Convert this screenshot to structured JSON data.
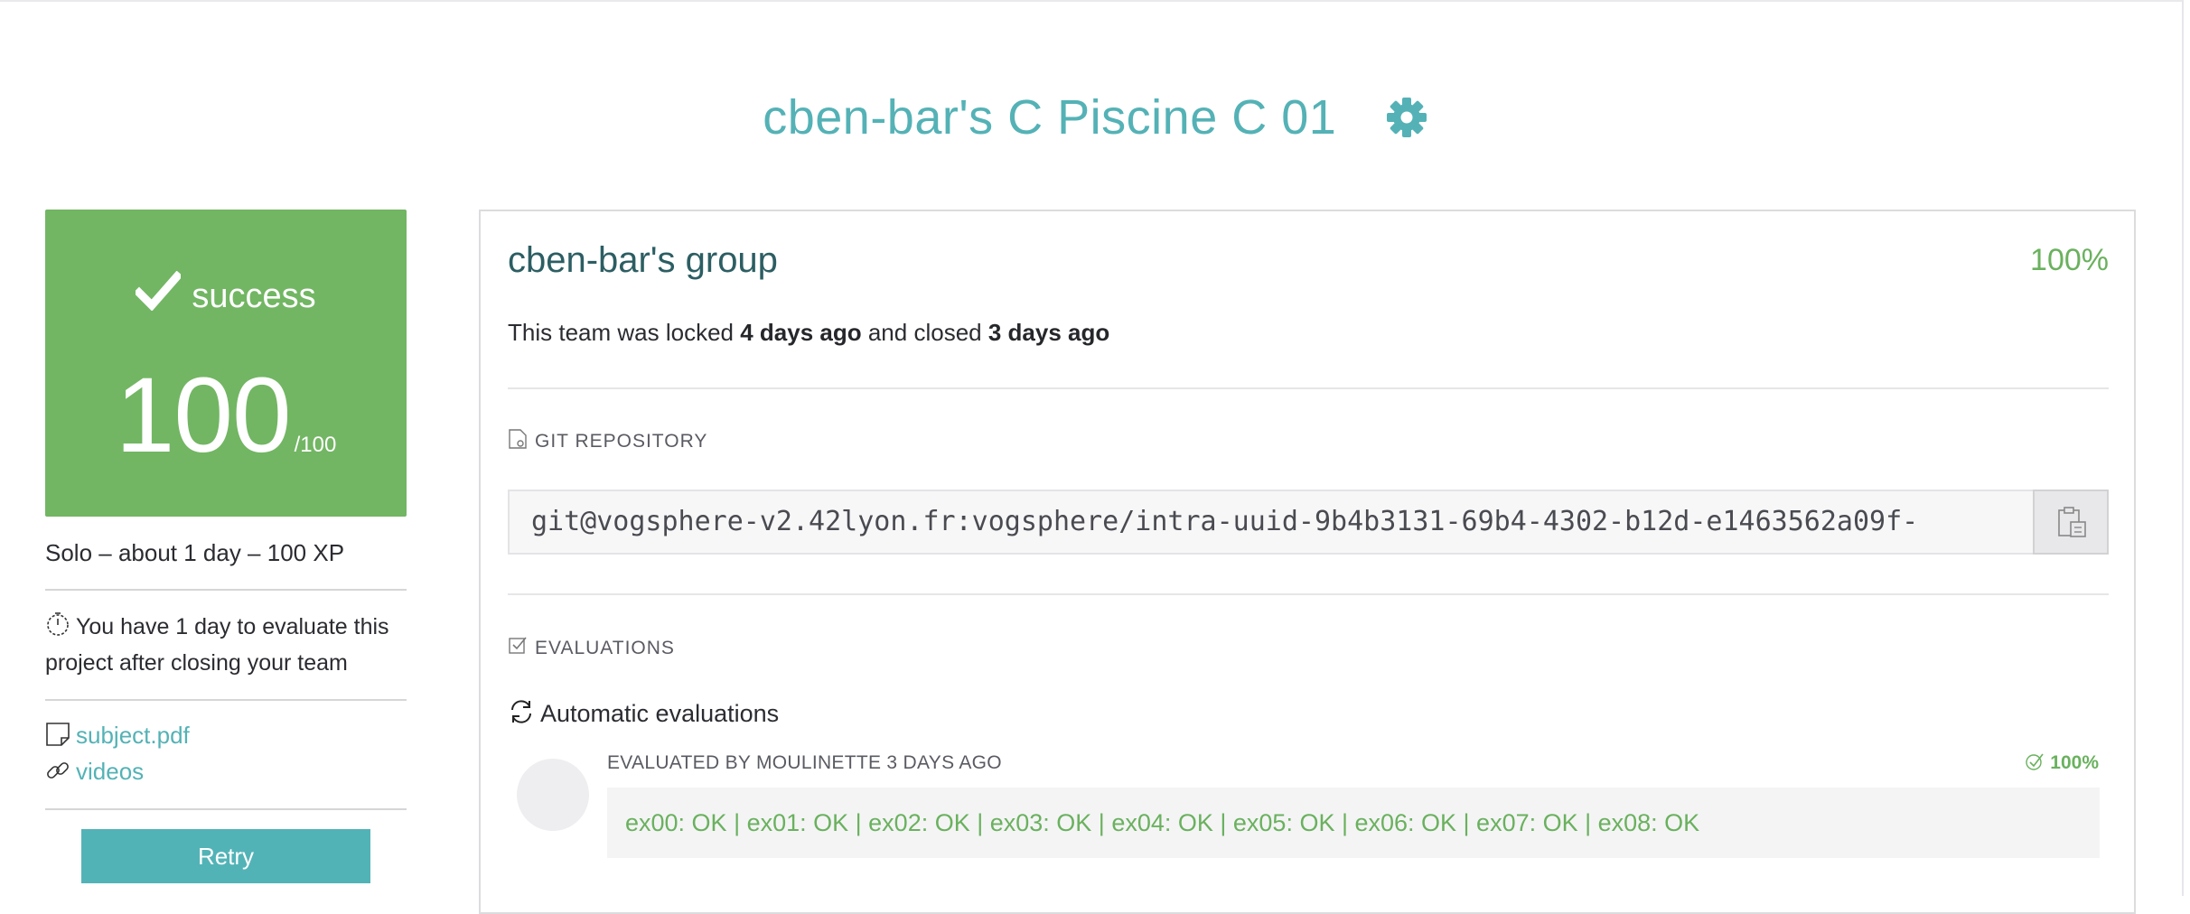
{
  "page": {
    "title": "cben-bar's C Piscine C 01"
  },
  "score_card": {
    "status": "success",
    "score": "100",
    "max": "/100"
  },
  "sidebar": {
    "meta": "Solo – about 1 day – 100 XP",
    "deadline": "You have 1 day to evaluate this project after closing your team",
    "links": [
      {
        "label": "subject.pdf",
        "icon": "file-icon"
      },
      {
        "label": "videos",
        "icon": "link-icon"
      }
    ],
    "retry_label": "Retry"
  },
  "team": {
    "name": "cben-bar's group",
    "percent": "100%",
    "lock_prefix": "This team was locked ",
    "locked_when": "4 days ago",
    "lock_middle": " and closed ",
    "closed_when": "3 days ago"
  },
  "git": {
    "label": "GIT REPOSITORY",
    "url": "git@vogsphere-v2.42lyon.fr:vogsphere/intra-uuid-9b4b3131-69b4-4302-b12d-e1463562a09f-"
  },
  "evaluations": {
    "label": "EVALUATIONS",
    "auto_title": "Automatic evaluations",
    "evaluated_by": "EVALUATED BY MOULINETTE 3 DAYS AGO",
    "percent": "100%",
    "result": "ex00: OK | ex01: OK | ex02: OK | ex03: OK | ex04: OK | ex05: OK | ex06: OK | ex07: OK | ex08: OK"
  },
  "colors": {
    "accent": "#54b2b6",
    "success": "#72b663",
    "success_text": "#6ab15e",
    "group_title": "#2c5e63"
  }
}
